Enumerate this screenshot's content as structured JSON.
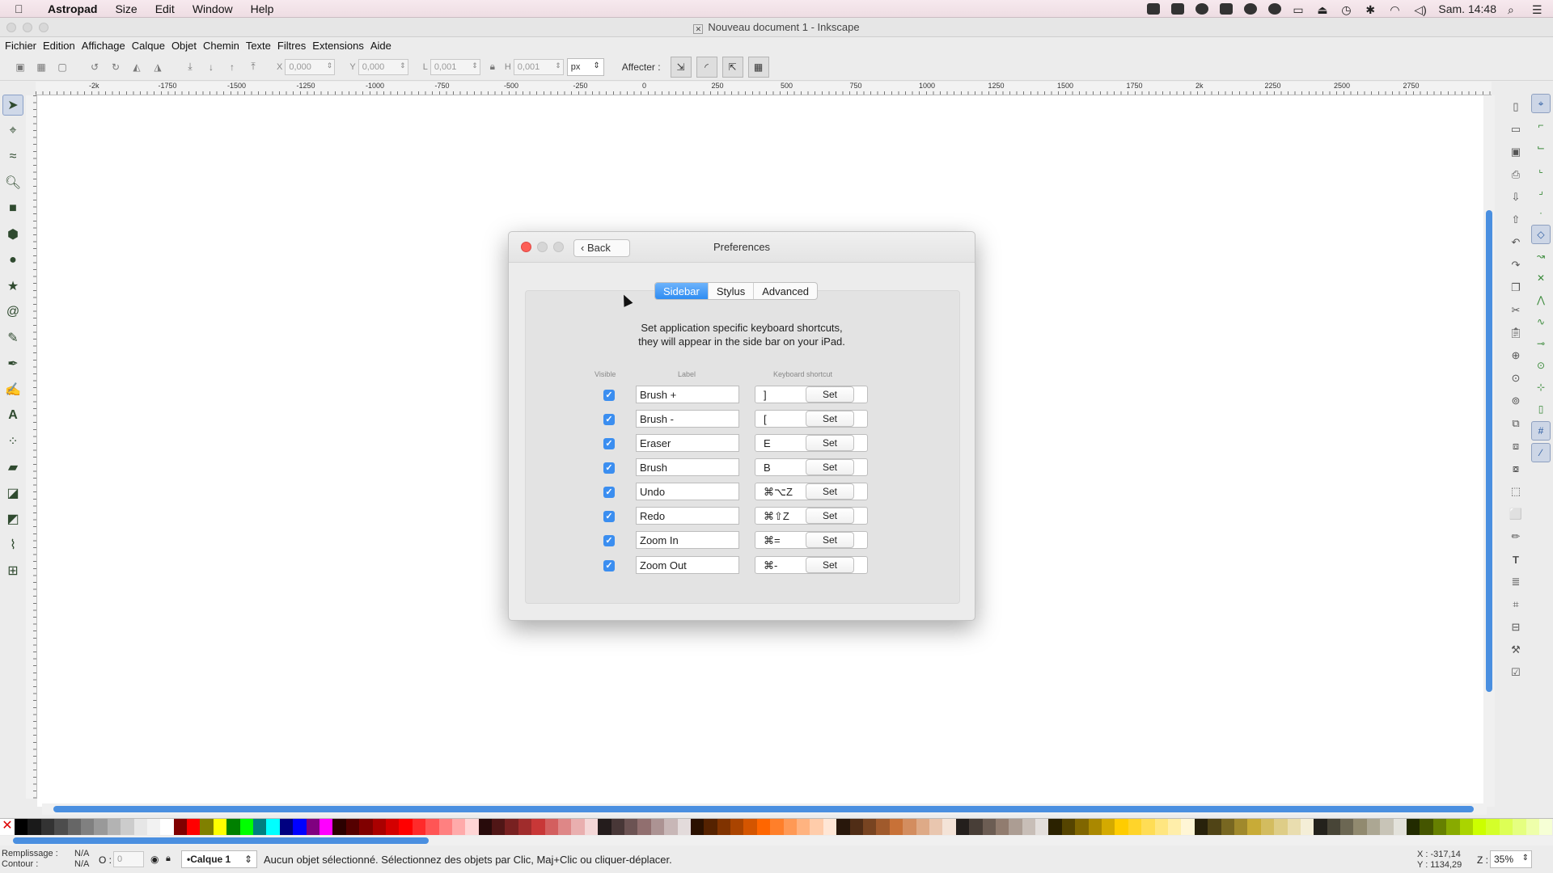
{
  "menubar": {
    "app_name": "Astropad",
    "items": [
      "Size",
      "Edit",
      "Window",
      "Help"
    ],
    "clock": "Sam. 14:48"
  },
  "window": {
    "title": "Nouveau document 1 - Inkscape"
  },
  "appmenu": {
    "items": [
      "Fichier",
      "Edition",
      "Affichage",
      "Calque",
      "Objet",
      "Chemin",
      "Texte",
      "Filtres",
      "Extensions",
      "Aide"
    ]
  },
  "toolbar": {
    "x_label": "X",
    "x_value": "0,000",
    "y_label": "Y",
    "y_value": "0,000",
    "w_label": "L",
    "w_value": "0,001",
    "h_label": "H",
    "h_value": "0,001",
    "unit": "px",
    "affecter_label": "Affecter :"
  },
  "ruler": {
    "labels": [
      "-2k",
      "-1750",
      "-1500",
      "-1250",
      "-1000",
      "-750",
      "-500",
      "-250",
      "0",
      "250",
      "500",
      "750",
      "1000",
      "1250",
      "1500",
      "1750",
      "2k",
      "2250",
      "2500",
      "2750"
    ]
  },
  "dialog": {
    "title": "Preferences",
    "back_label": "Back",
    "tabs": [
      {
        "label": "Sidebar",
        "active": true
      },
      {
        "label": "Stylus",
        "active": false
      },
      {
        "label": "Advanced",
        "active": false
      }
    ],
    "description_line1": "Set application specific keyboard shortcuts,",
    "description_line2": "they will appear in the side bar on your iPad.",
    "col_visible": "Visible",
    "col_label": "Label",
    "col_shortcut": "Keyboard shortcut",
    "set_label": "Set",
    "shortcuts": [
      {
        "visible": true,
        "label": "Brush +",
        "key": "]"
      },
      {
        "visible": true,
        "label": "Brush -",
        "key": "["
      },
      {
        "visible": true,
        "label": "Eraser",
        "key": "E"
      },
      {
        "visible": true,
        "label": "Brush",
        "key": "B"
      },
      {
        "visible": true,
        "label": "Undo",
        "key": "⌘⌥Z"
      },
      {
        "visible": true,
        "label": "Redo",
        "key": "⌘⇧Z"
      },
      {
        "visible": true,
        "label": "Zoom In",
        "key": "⌘="
      },
      {
        "visible": true,
        "label": "Zoom Out",
        "key": "⌘-"
      }
    ]
  },
  "palette": {
    "colors": [
      "#000000",
      "#1a1a1a",
      "#333333",
      "#4d4d4d",
      "#666666",
      "#808080",
      "#999999",
      "#b3b3b3",
      "#cccccc",
      "#e6e6e6",
      "#f2f2f2",
      "#ffffff",
      "#800000",
      "#ff0000",
      "#808000",
      "#ffff00",
      "#008000",
      "#00ff00",
      "#008080",
      "#00ffff",
      "#000080",
      "#0000ff",
      "#800080",
      "#ff00ff",
      "#2b0000",
      "#550000",
      "#800000",
      "#aa0000",
      "#d40000",
      "#ff0000",
      "#ff2a2a",
      "#ff5555",
      "#ff8080",
      "#ffaaaa",
      "#ffd5d5",
      "#280b0b",
      "#501616",
      "#782121",
      "#a02c2c",
      "#c83737",
      "#d35f5f",
      "#de8787",
      "#e9afaf",
      "#f4d7d7",
      "#241c1c",
      "#483737",
      "#6c5353",
      "#916f6f",
      "#ac9393",
      "#c8b7b7",
      "#e3dbdb",
      "#2b1100",
      "#552200",
      "#803300",
      "#aa4400",
      "#d45500",
      "#ff6600",
      "#ff7f2a",
      "#ff9955",
      "#ffb380",
      "#ffccaa",
      "#ffe6d5",
      "#28170b",
      "#502d16",
      "#784421",
      "#a05a2c",
      "#c87137",
      "#d38d5f",
      "#deaa87",
      "#e9c6af",
      "#f4e3d7",
      "#241f1c",
      "#483e37",
      "#6c5d53",
      "#917c6f",
      "#ac9d93",
      "#c8beb7",
      "#e3dedb",
      "#2b2200",
      "#554400",
      "#806600",
      "#aa8800",
      "#d4aa00",
      "#ffcc00",
      "#ffd42a",
      "#ffdd55",
      "#ffe680",
      "#ffeeaa",
      "#fff6d5",
      "#28220b",
      "#504416",
      "#786721",
      "#a0892c",
      "#c8ab37",
      "#d3bc5f",
      "#decd87",
      "#e9ddaf",
      "#f4eed7",
      "#24221c",
      "#484537",
      "#6c6753",
      "#918a6f",
      "#aca793",
      "#c8c4b7",
      "#e3e2db",
      "#222b00",
      "#445500",
      "#668000",
      "#88aa00",
      "#aad400",
      "#ccff00",
      "#d4ff2a",
      "#ddff55",
      "#e5ff80",
      "#eeffaa",
      "#f6ffd5"
    ]
  },
  "statusbar": {
    "fill_label": "Remplissage :",
    "stroke_label": "Contour :",
    "fill_value": "N/A",
    "stroke_value": "N/A",
    "opacity_label": "O :",
    "opacity_value": "0",
    "layer": "•Calque 1",
    "message": "Aucun objet sélectionné. Sélectionnez des objets par Clic, Maj+Clic ou cliquer-déplacer.",
    "coord_x": "X : -317,14",
    "coord_y": "Y : 1134,29",
    "zoom_label": "Z :",
    "zoom_value": "35%"
  }
}
